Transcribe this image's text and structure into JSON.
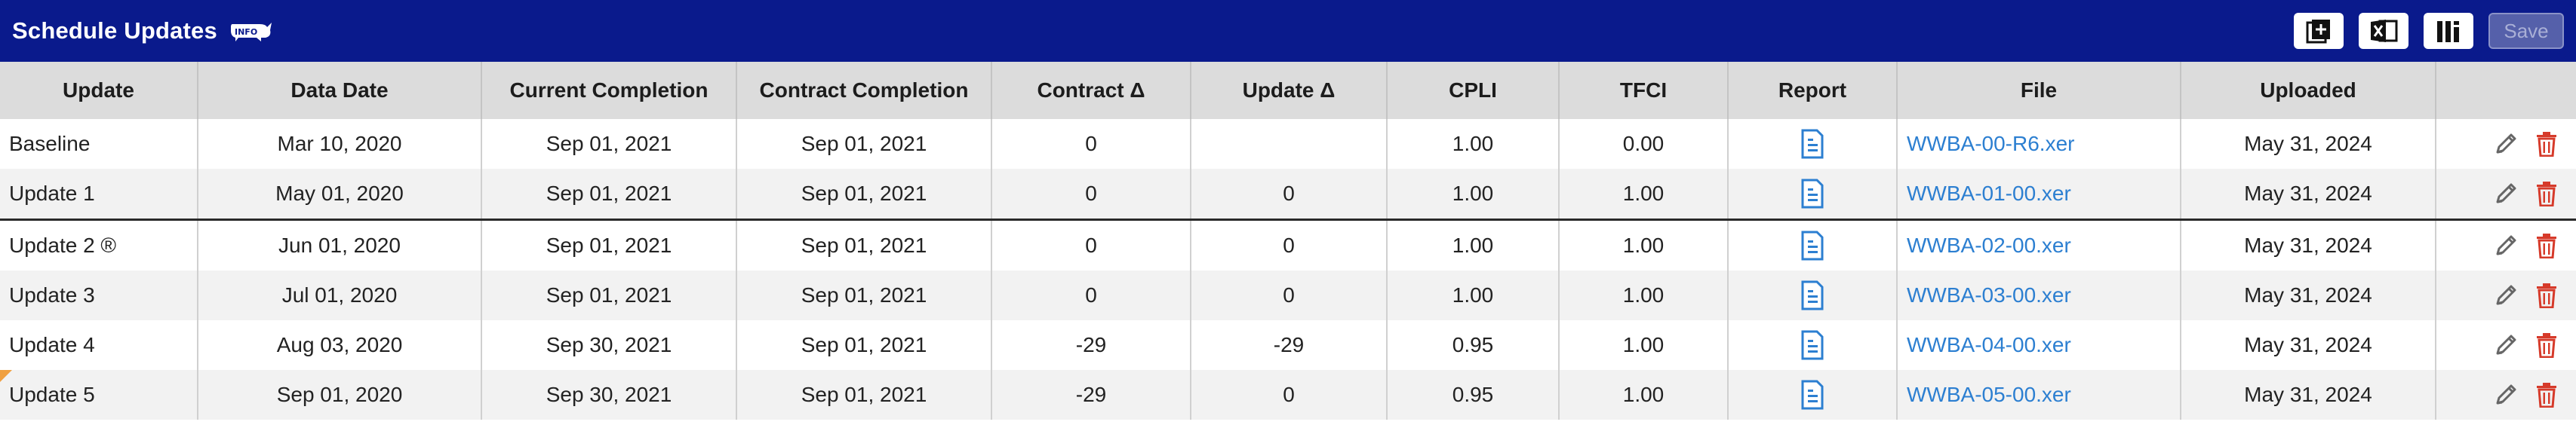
{
  "header": {
    "title": "Schedule Updates",
    "info_badge": "INFO",
    "save_label": "Save"
  },
  "toolbar_icons": [
    "add-document-icon",
    "excel-icon",
    "columns-icon"
  ],
  "colors": {
    "header_bg": "#0a1a8c",
    "link": "#2c7fd1",
    "delete": "#d63a2a",
    "column_header_bg": "#dcdcdc"
  },
  "table": {
    "columns": [
      "Update",
      "Data Date",
      "Current Completion",
      "Contract Completion",
      "Contract Δ",
      "Update Δ",
      "CPLI",
      "TFCI",
      "Report",
      "File",
      "Uploaded",
      ""
    ],
    "rows": [
      {
        "update": "Baseline",
        "data_date": "Mar 10, 2020",
        "current_completion": "Sep 01, 2021",
        "contract_completion": "Sep 01, 2021",
        "contract_delta": "0",
        "update_delta": "",
        "cpli": "1.00",
        "tfci": "0.00",
        "file": "WWBA-00-R6.xer",
        "uploaded": "May 31, 2024"
      },
      {
        "update": "Update 1",
        "data_date": "May 01, 2020",
        "current_completion": "Sep 01, 2021",
        "contract_completion": "Sep 01, 2021",
        "contract_delta": "0",
        "update_delta": "0",
        "cpli": "1.00",
        "tfci": "1.00",
        "file": "WWBA-01-00.xer",
        "uploaded": "May 31, 2024"
      },
      {
        "update": "Update 2 ®",
        "data_date": "Jun 01, 2020",
        "current_completion": "Sep 01, 2021",
        "contract_completion": "Sep 01, 2021",
        "contract_delta": "0",
        "update_delta": "0",
        "cpli": "1.00",
        "tfci": "1.00",
        "file": "WWBA-02-00.xer",
        "uploaded": "May 31, 2024"
      },
      {
        "update": "Update 3",
        "data_date": "Jul 01, 2020",
        "current_completion": "Sep 01, 2021",
        "contract_completion": "Sep 01, 2021",
        "contract_delta": "0",
        "update_delta": "0",
        "cpli": "1.00",
        "tfci": "1.00",
        "file": "WWBA-03-00.xer",
        "uploaded": "May 31, 2024"
      },
      {
        "update": "Update 4",
        "data_date": "Aug 03, 2020",
        "current_completion": "Sep 30, 2021",
        "contract_completion": "Sep 01, 2021",
        "contract_delta": "-29",
        "update_delta": "-29",
        "cpli": "0.95",
        "tfci": "1.00",
        "file": "WWBA-04-00.xer",
        "uploaded": "May 31, 2024"
      },
      {
        "update": "Update 5",
        "data_date": "Sep 01, 2020",
        "current_completion": "Sep 30, 2021",
        "contract_completion": "Sep 01, 2021",
        "contract_delta": "-29",
        "update_delta": "0",
        "cpli": "0.95",
        "tfci": "1.00",
        "file": "WWBA-05-00.xer",
        "uploaded": "May 31, 2024"
      }
    ]
  }
}
